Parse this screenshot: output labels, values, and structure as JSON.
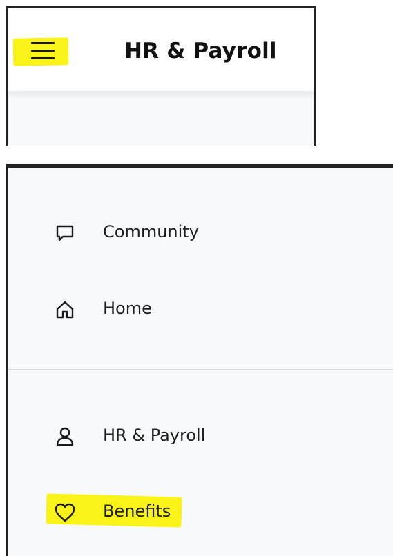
{
  "header": {
    "title": "HR & Payroll",
    "menu_icon": "hamburger-menu-icon"
  },
  "nav": {
    "items": [
      {
        "label": "Community",
        "icon": "chat-bubble-icon"
      },
      {
        "label": "Home",
        "icon": "home-icon"
      },
      {
        "label": "HR & Payroll",
        "icon": "person-icon"
      },
      {
        "label": "Benefits",
        "icon": "heart-icon"
      }
    ]
  },
  "colors": {
    "highlight": "#f9f31a",
    "text": "#1f1f1f",
    "panel_background": "#f7f9fb",
    "header_background": "#ffffff",
    "border": "#222222",
    "divider": "#d8dde3"
  }
}
